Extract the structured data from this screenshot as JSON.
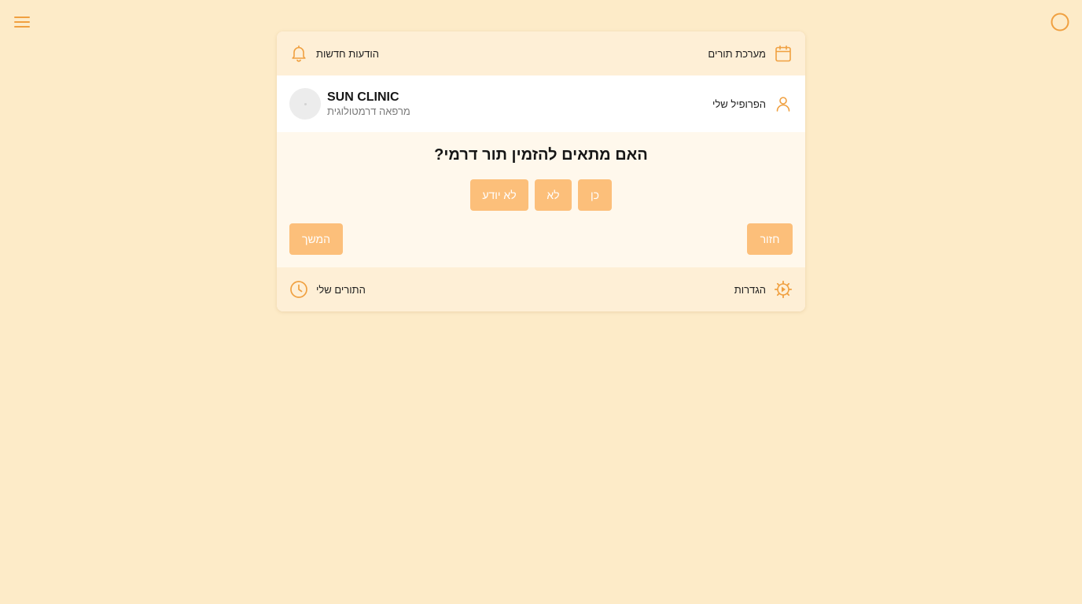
{
  "topbar": {
    "menu_icon": "hamburger-icon",
    "status_icon": "circle-icon"
  },
  "card": {
    "header": {
      "appointments_label": "מערכת תורים",
      "appointments_icon": "calendar-icon",
      "notifications_label": "הודעות חדשות",
      "notifications_icon": "bell-icon"
    },
    "profile": {
      "my_profile_label": "הפרופיל שלי",
      "my_profile_icon": "user-icon",
      "clinic_name": "SUN CLINIC",
      "clinic_subtitle": "מרפאה דרמטולוגית"
    },
    "question": {
      "text": "האם מתאים להזמין תור דרמי?",
      "answers": {
        "yes": "כן",
        "no": "לא",
        "dont_know": "לא יודע"
      },
      "back_label": "חזור",
      "next_label": "המשך"
    },
    "footer": {
      "settings_label": "הגדרות",
      "settings_icon": "gear-icon",
      "my_appointments_label": "התורים שלי",
      "my_appointments_icon": "clock-icon"
    }
  },
  "colors": {
    "background": "#fdebc8",
    "accent": "#f0a040",
    "button": "#fcbf7a"
  }
}
